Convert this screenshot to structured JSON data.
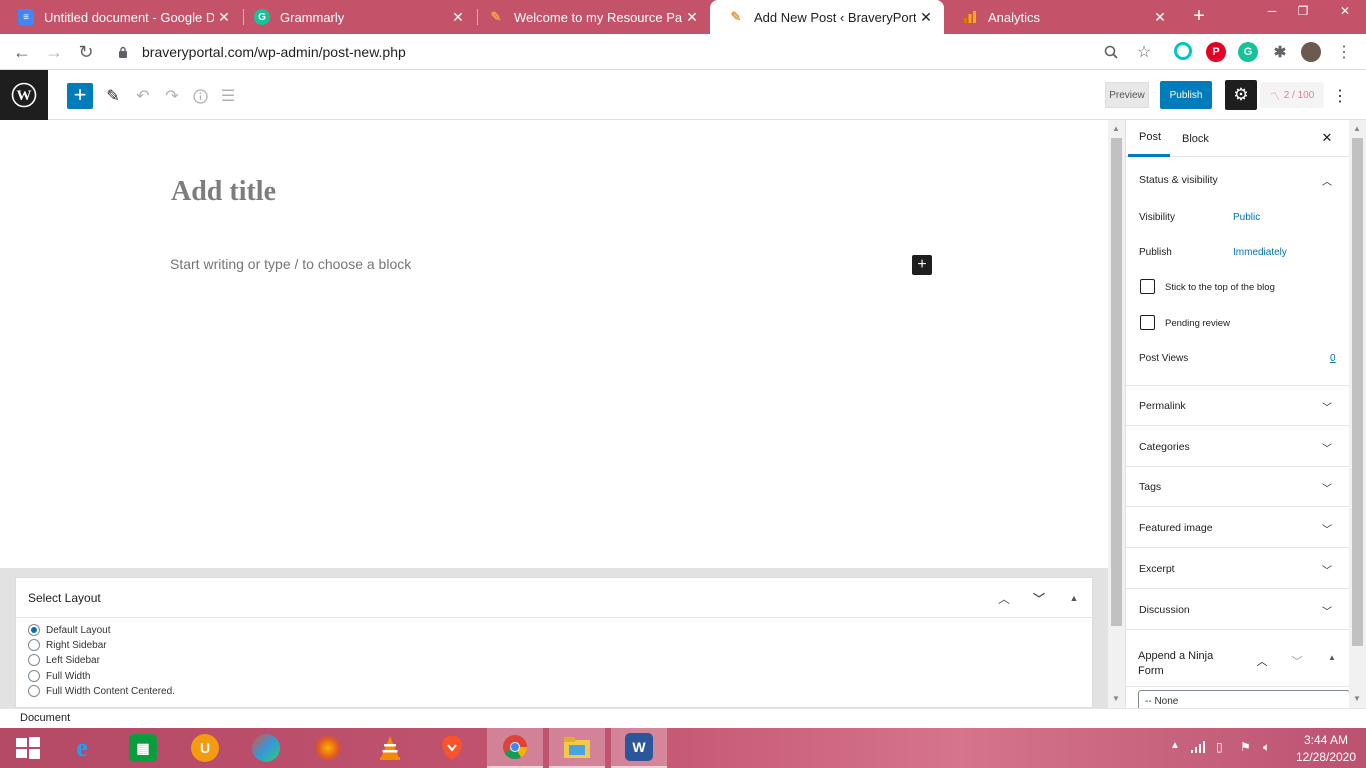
{
  "browser": {
    "tabs": [
      {
        "title": "Untitled document - Google Do",
        "favicon": "google-docs-icon",
        "color": "#4285f4"
      },
      {
        "title": "Grammarly",
        "favicon": "grammarly-icon",
        "color": "#15c39a"
      },
      {
        "title": "Welcome to my Resource Page",
        "favicon": "site-icon",
        "color": "#e8a33a"
      },
      {
        "title": "Add New Post ‹ BraveryPortal —",
        "favicon": "site-icon",
        "color": "#e8a33a",
        "active": true
      },
      {
        "title": "Analytics",
        "favicon": "analytics-icon",
        "color": "#f9ab00"
      }
    ],
    "url": "braveryportal.com/wp-admin/post-new.php"
  },
  "wp": {
    "preview_label": "Preview",
    "publish_label": "Publish",
    "counter": "2 / 100",
    "title_placeholder": "Add title",
    "block_placeholder": "Start writing or type / to choose a block",
    "footer": "Document"
  },
  "metabox": {
    "title": "Select Layout",
    "options": [
      {
        "label": "Default Layout",
        "checked": true
      },
      {
        "label": "Right Sidebar",
        "checked": false
      },
      {
        "label": "Left Sidebar",
        "checked": false
      },
      {
        "label": "Full Width",
        "checked": false
      },
      {
        "label": "Full Width Content Centered.",
        "checked": false
      }
    ]
  },
  "sidebar": {
    "tab_post": "Post",
    "tab_block": "Block",
    "status_title": "Status & visibility",
    "visibility_label": "Visibility",
    "visibility_value": "Public",
    "publish_label": "Publish",
    "publish_value": "Immediately",
    "stick_label": "Stick to the top of the blog",
    "pending_label": "Pending review",
    "views_label": "Post Views",
    "views_value": "0",
    "panels": [
      "Permalink",
      "Categories",
      "Tags",
      "Featured image",
      "Excerpt",
      "Discussion"
    ],
    "ninja_title": "Append a Ninja Form",
    "ninja_select": "-- None"
  },
  "taskbar": {
    "time": "3:44 AM",
    "date": "12/28/2020"
  },
  "colors": {
    "accent": "#007cba",
    "tabstrip": "#c4536a"
  }
}
